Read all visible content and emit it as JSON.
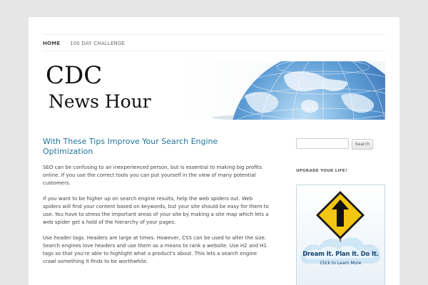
{
  "nav": {
    "items": [
      {
        "label": "HOME"
      },
      {
        "label": "100 DAY CHALLENGE"
      }
    ]
  },
  "header": {
    "line1": "CDC",
    "line2": "News Hour"
  },
  "post": {
    "title": "With These Tips Improve Your Search Engine Optimization",
    "paragraphs": [
      "SEO can be confusing to an inexperienced person, but is essential to making big profits online. If you use the correct tools you can put yourself in the view of many potential customers.",
      "If you want to be higher up on search engine results, help the web spiders out. Web spiders will find your content based on keywords, but your site should be easy for them to use. You have to stress the important areas of your site by making a site map which lets a web spider get a hold of the hierarchy of your pages.",
      "Use header tags. Headers are large at times. However, CSS can be used to alter the size. Search engines love headers and use them as a means to rank a website. Use H2 and H1 tags so that you're able to highlight what a product's about. This lets a search engine crawl something it finds to be worthwhile."
    ]
  },
  "sidebar": {
    "search": {
      "value": "",
      "button": "Search"
    },
    "widget_title": "UPGRADE YOUR LIFE!",
    "ad": {
      "line1": "Dream It. Plan It. Do It.",
      "line2": "Click to Learn More"
    }
  },
  "colors": {
    "link": "#21759b",
    "background": "#e6e6e6",
    "sign_yellow": "#f3c614"
  },
  "icons": {
    "header_image": "globe-icon",
    "ad_sign": "arrow-up-sign-icon"
  }
}
